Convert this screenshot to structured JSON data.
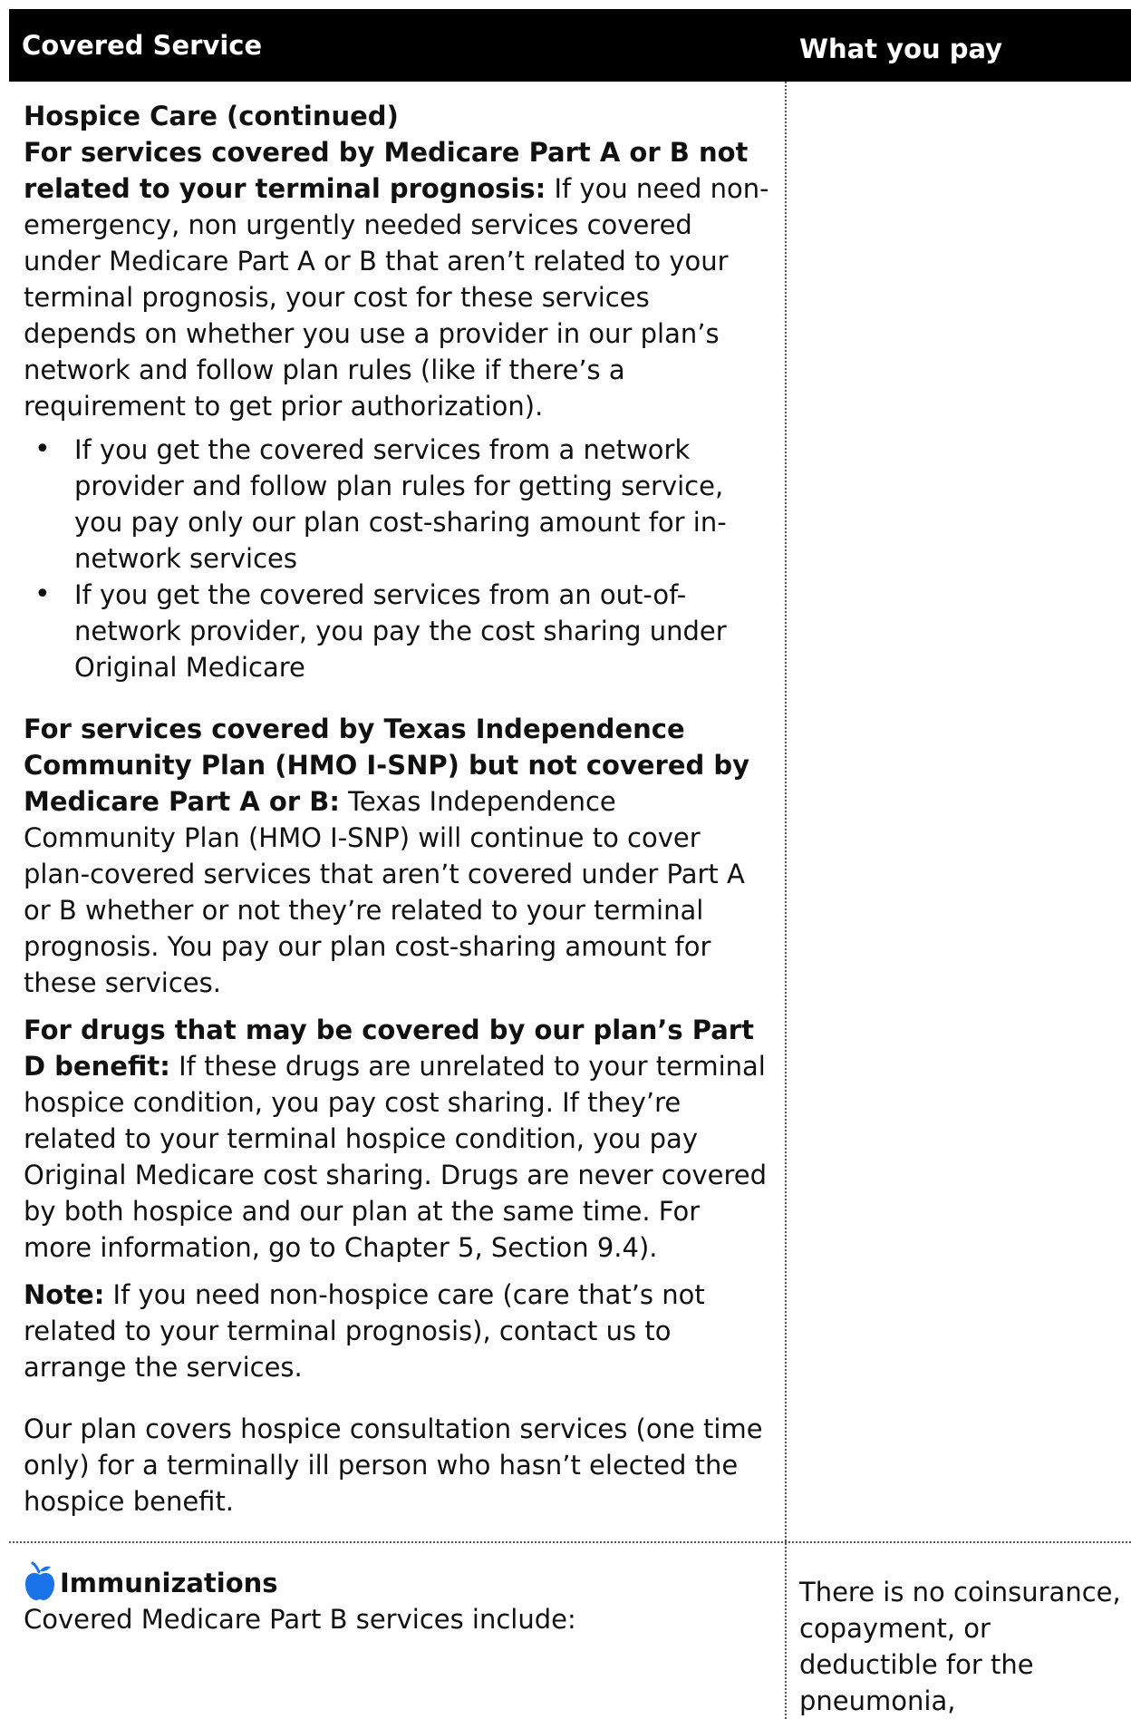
{
  "header": {
    "col1": "Covered Service",
    "col2": "What you pay"
  },
  "hospice": {
    "title": "Hospice Care (continued)",
    "p1_bold": "For services covered by Medicare Part A or B not related to your terminal prognosis:",
    "p1_text": " If you need non-emergency, non urgently needed services covered under Medicare Part A or B that aren’t related to your terminal prognosis, your cost for these services depends on whether you use a provider in our plan’s network and follow plan rules (like if there’s a requirement to get prior authorization).",
    "bullets": [
      "If you get the covered services from a network provider and follow plan rules for getting service, you pay only our plan cost-sharing amount for in-network services",
      "If you get the covered services from an out-of-network provider, you pay the cost sharing under Original Medicare"
    ],
    "p2_bold": "For services covered by Texas Independence Community Plan (HMO I-SNP) but not covered by Medicare Part A or B:",
    "p2_text": " Texas Independence Community Plan (HMO I-SNP) will continue to cover plan-covered services that aren’t covered under Part A or B whether or not they’re related to your terminal prognosis. You pay our plan cost-sharing amount for these services.",
    "p3_bold": "For drugs that may be covered by our plan’s Part D benefit:",
    "p3_text": " If these drugs are unrelated to your terminal hospice condition, you pay cost sharing. If they’re related to your terminal hospice condition, you pay Original Medicare cost sharing. Drugs are never covered by both hospice and our plan at the same time. For more information, go to Chapter 5, Section 9.4).",
    "note_bold": "Note:",
    "note_text": " If you need non-hospice care (care that’s not related to your terminal prognosis), contact us to arrange the services.",
    "p4_text": "Our plan covers hospice consultation services (one time only) for a terminally ill person who hasn’t elected the hospice benefit."
  },
  "immunizations": {
    "icon": "apple-icon",
    "icon_color": "#1a73e8",
    "title": "Immunizations",
    "subtitle": "Covered Medicare Part B services include:",
    "pay_text": "There is no coinsurance, copayment, or deductible for the pneumonia,"
  }
}
